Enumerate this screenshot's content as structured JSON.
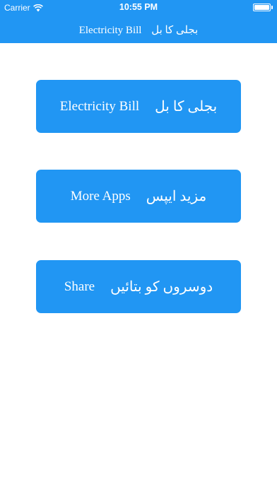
{
  "status_bar": {
    "carrier": "Carrier",
    "time": "10:55 PM"
  },
  "nav": {
    "title_en": "Electricity Bill",
    "title_ur": "بجلی کا بل"
  },
  "buttons": [
    {
      "label_en": "Electricity Bill",
      "label_ur": "بجلی کا بل"
    },
    {
      "label_en": "More Apps",
      "label_ur": "مزید ایپس"
    },
    {
      "label_en": "Share",
      "label_ur": "دوسروں کو بتائیں"
    }
  ],
  "colors": {
    "accent": "#2196f3",
    "text_on_accent": "#ffffff",
    "background": "#ffffff"
  },
  "icons": [
    "wifi-icon",
    "battery-icon"
  ]
}
